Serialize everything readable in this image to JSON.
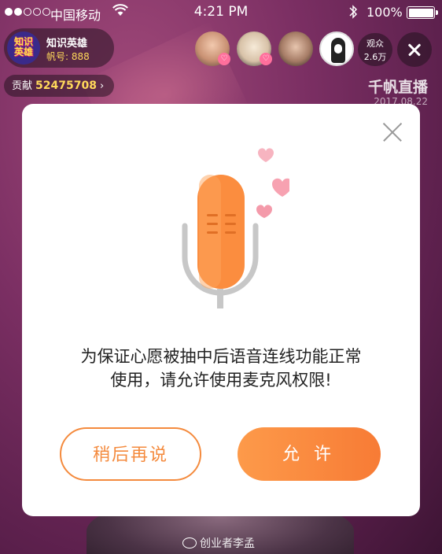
{
  "status_bar": {
    "carrier": "中国移动",
    "time": "4:21 PM",
    "battery": "100%"
  },
  "host": {
    "badge_text": "知识英雄",
    "name": "知识英雄",
    "id_text": "帆号: 888"
  },
  "viewers": {
    "audience_label": "观众",
    "audience_count": "2.6万"
  },
  "contribution": {
    "label": "贡献",
    "value": "52475708",
    "chevron": "›"
  },
  "watermark_brand": {
    "name": "千帆直播",
    "date": "2017.08.22"
  },
  "dialog": {
    "message_line1": "为保证心愿被抽中后语音连线功能正常",
    "message_line2": "使用，请允许使用麦克风权限!",
    "later_button": "稍后再说",
    "allow_button": "允 许"
  },
  "credit": {
    "text": "创业者李孟"
  },
  "colors": {
    "accent": "#f7843a",
    "mic_orange": "#fb8d3f",
    "heart_pink": "#f7a2b1",
    "background": "#7b2f63"
  }
}
